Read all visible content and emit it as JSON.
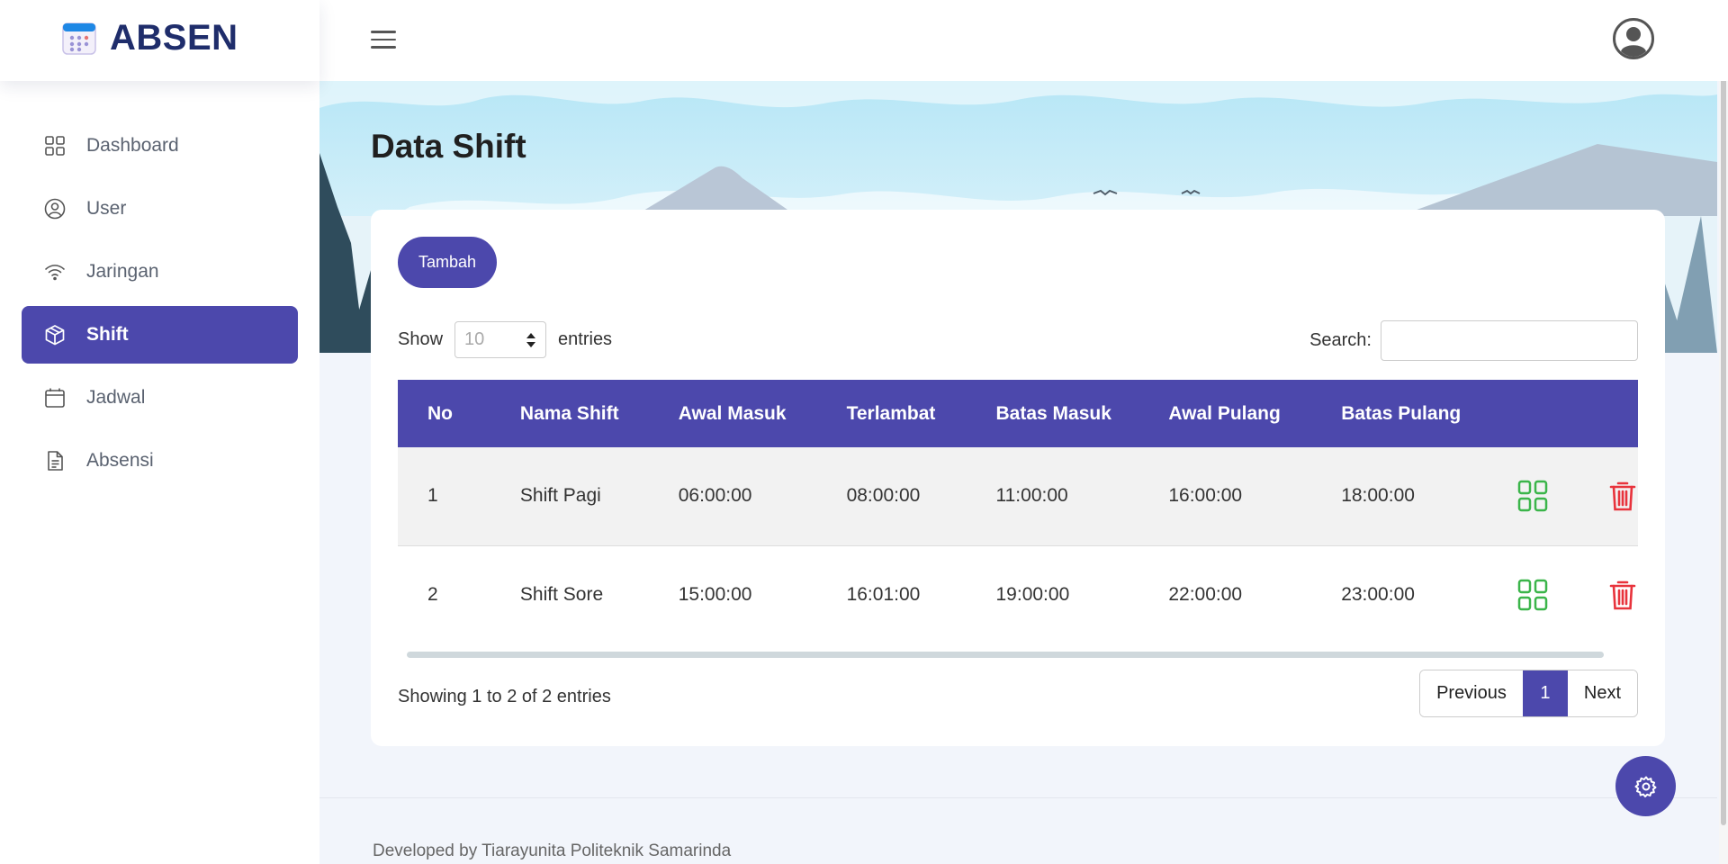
{
  "app": {
    "name": "ABSEN"
  },
  "sidebar": {
    "items": [
      {
        "label": "Dashboard",
        "icon": "grid-icon",
        "active": false
      },
      {
        "label": "User",
        "icon": "user-circle-icon",
        "active": false
      },
      {
        "label": "Jaringan",
        "icon": "wifi-icon",
        "active": false
      },
      {
        "label": "Shift",
        "icon": "box-icon",
        "active": true
      },
      {
        "label": "Jadwal",
        "icon": "calendar-icon",
        "active": false
      },
      {
        "label": "Absensi",
        "icon": "document-icon",
        "active": false
      }
    ]
  },
  "page": {
    "title": "Data Shift"
  },
  "toolbar": {
    "add_label": "Tambah"
  },
  "datatable": {
    "show_label": "Show",
    "entries_label": "entries",
    "length_value": "10",
    "search_label": "Search:",
    "search_value": "",
    "columns": [
      "No",
      "Nama Shift",
      "Awal Masuk",
      "Terlambat",
      "Batas Masuk",
      "Awal Pulang",
      "Batas Pulang"
    ],
    "rows": [
      [
        "1",
        "Shift Pagi",
        "06:00:00",
        "08:00:00",
        "11:00:00",
        "16:00:00",
        "18:00:00"
      ],
      [
        "2",
        "Shift Sore",
        "15:00:00",
        "16:01:00",
        "19:00:00",
        "22:00:00",
        "23:00:00"
      ]
    ],
    "info": "Showing 1 to 2 of 2 entries",
    "pagination": {
      "previous": "Previous",
      "current": "1",
      "next": "Next"
    }
  },
  "footer": {
    "text": "Developed by Tiarayunita Politeknik Samarinda"
  },
  "colors": {
    "accent": "#4c48ac",
    "brand_text": "#1f2d6b",
    "edit_icon": "#3bb54a",
    "delete_icon": "#e8333c"
  }
}
